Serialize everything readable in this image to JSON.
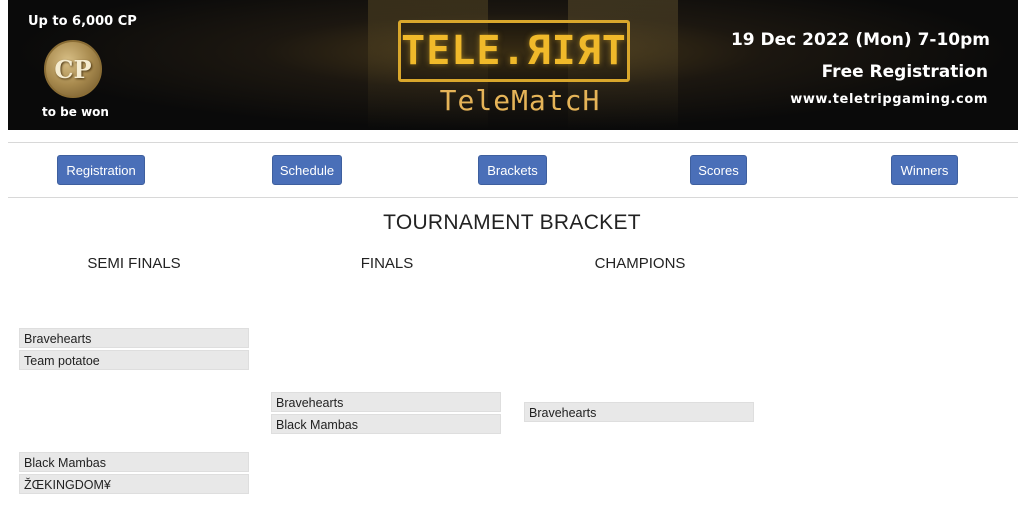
{
  "banner": {
    "prize_top": "Up to 6,000 CP",
    "coin_label": "CP",
    "prize_bottom": "to be won",
    "logo_main": "TELE.ЯIЯT",
    "logo_sub": "TeleMatcH",
    "date_time": "19 Dec 2022 (Mon) 7-10pm",
    "registration": "Free Registration",
    "website": "www.teletripgaming.com"
  },
  "nav": {
    "items": [
      {
        "label": "Registration"
      },
      {
        "label": "Schedule"
      },
      {
        "label": "Brackets"
      },
      {
        "label": "Scores"
      },
      {
        "label": "Winners"
      }
    ]
  },
  "bracket": {
    "title": "TOURNAMENT BRACKET",
    "rounds": [
      {
        "name": "SEMI FINALS"
      },
      {
        "name": "FINALS"
      },
      {
        "name": "CHAMPIONS"
      }
    ],
    "semi_finals": [
      {
        "team_a": "Bravehearts",
        "team_b": "Team potatoe"
      },
      {
        "team_a": "Black Mambas",
        "team_b": "ŽŒKINGDOM¥"
      }
    ],
    "finals": {
      "team_a": "Bravehearts",
      "team_b": "Black Mambas"
    },
    "champion": "Bravehearts"
  }
}
